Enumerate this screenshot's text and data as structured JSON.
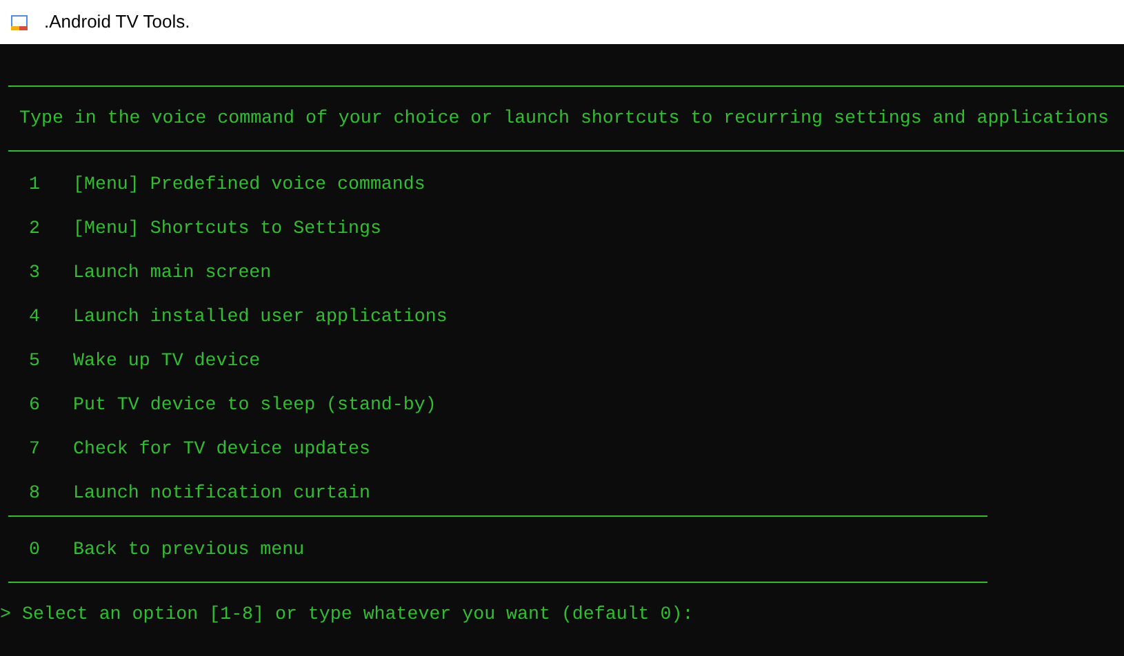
{
  "window": {
    "title": ".Android TV Tools."
  },
  "header": "Type in the voice command of your choice or launch shortcuts to recurring settings and applications",
  "options": [
    {
      "number": "1",
      "label": "[Menu] Predefined voice commands"
    },
    {
      "number": "2",
      "label": "[Menu] Shortcuts to Settings"
    },
    {
      "number": "3",
      "label": "Launch main screen"
    },
    {
      "number": "4",
      "label": "Launch installed user applications"
    },
    {
      "number": "5",
      "label": "Wake up TV device"
    },
    {
      "number": "6",
      "label": "Put TV device to sleep (stand-by)"
    },
    {
      "number": "7",
      "label": "Check for TV device updates"
    },
    {
      "number": "8",
      "label": "Launch notification curtain"
    }
  ],
  "back_option": {
    "number": "0",
    "label": "Back to previous menu"
  },
  "prompt": "> Select an option [1-8] or type whatever you want (default 0):"
}
